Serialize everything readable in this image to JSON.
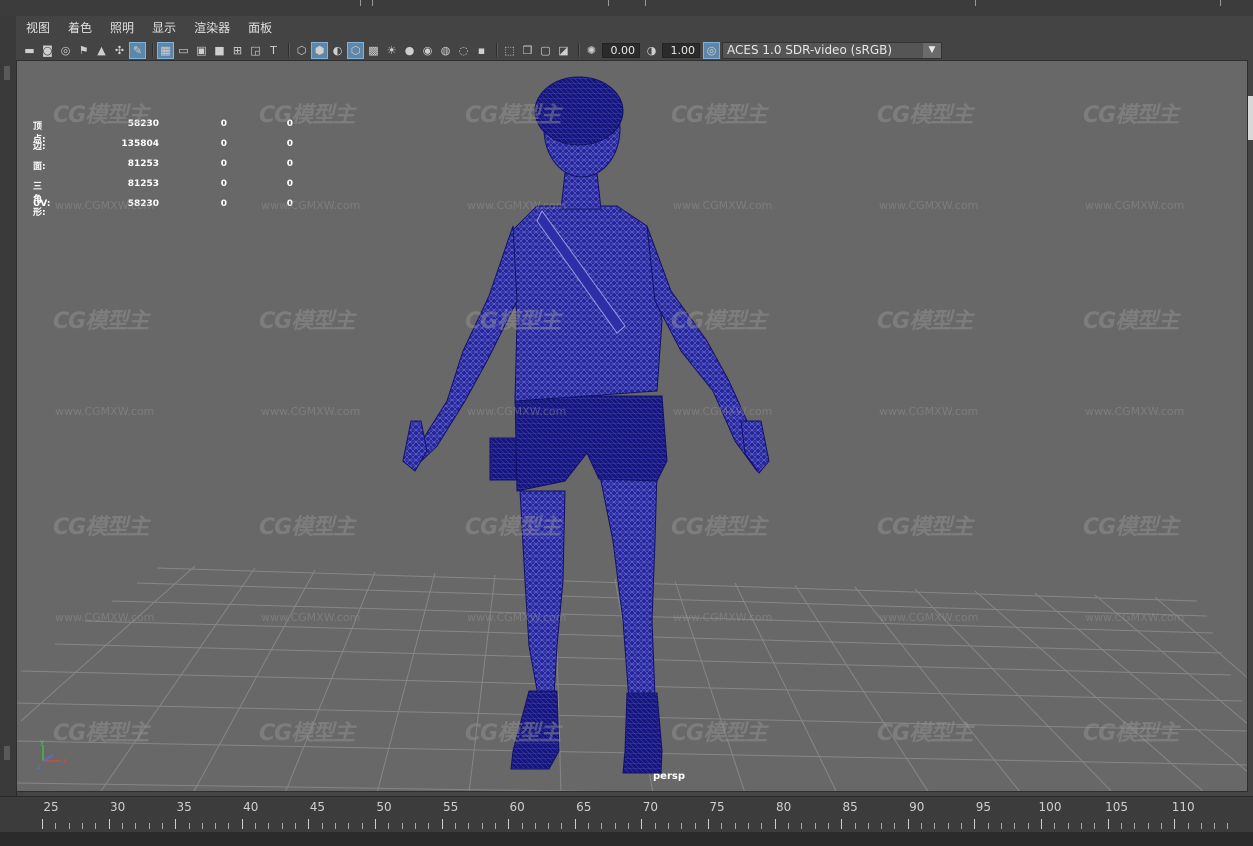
{
  "menu": [
    "视图",
    "着色",
    "照明",
    "显示",
    "渲染器",
    "面板"
  ],
  "toolbar": {
    "exposure_value": "0.00",
    "gamma_value": "1.00",
    "color_space": "ACES 1.0 SDR-video (sRGB)"
  },
  "hud": {
    "rows": [
      {
        "label": "顶点:",
        "v1": "58230",
        "v2": "0",
        "v3": "0"
      },
      {
        "label": "边:",
        "v1": "135804",
        "v2": "0",
        "v3": "0"
      },
      {
        "label": "面:",
        "v1": "81253",
        "v2": "0",
        "v3": "0"
      },
      {
        "label": "三角形:",
        "v1": "81253",
        "v2": "0",
        "v3": "0"
      },
      {
        "label": "UV:",
        "v1": "58230",
        "v2": "0",
        "v3": "0"
      }
    ]
  },
  "viewport": {
    "camera": "persp",
    "wireframe_color": "#1f1f8c",
    "background_color": "#686868"
  },
  "watermark": {
    "logo_text": "CG模型主",
    "url_text": "www.CGMXW.com"
  },
  "timeline": {
    "frames": [
      "25",
      "30",
      "35",
      "40",
      "45",
      "50",
      "55",
      "60",
      "65",
      "70",
      "75",
      "80",
      "85",
      "90",
      "95",
      "100",
      "105",
      "110"
    ]
  }
}
